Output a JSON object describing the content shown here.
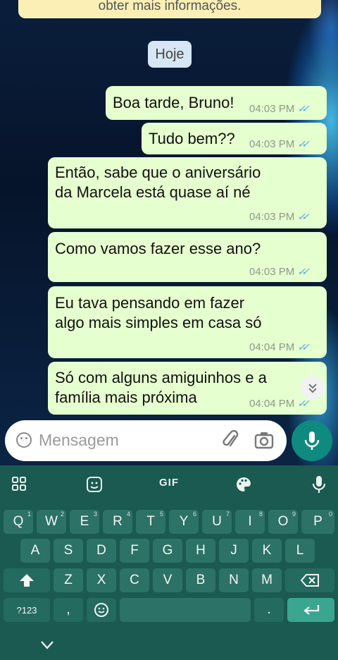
{
  "system_banner": "obter mais informações.",
  "date_chip": "Hoje",
  "messages": [
    {
      "text": "Boa tarde, Bruno!",
      "time": "04:03 PM"
    },
    {
      "text": "Tudo bem??",
      "time": "04:03 PM"
    },
    {
      "text_line1": "Então, sabe que o aniversário",
      "text_line2": "da Marcela está quase aí né",
      "time": "04:03 PM"
    },
    {
      "text": "Como vamos fazer esse ano?",
      "time": "04:03 PM"
    },
    {
      "text_line1": "Eu tava pensando em fazer",
      "text_line2": "algo mais simples em casa só",
      "time": "04:04 PM"
    },
    {
      "text_line1": "Só com alguns amiguinhos e a",
      "text_line2": "família mais próxima",
      "time": "04:04 PM"
    }
  ],
  "composer": {
    "placeholder": "Mensagem"
  },
  "keyboard": {
    "toolbar": {
      "gif": "GIF"
    },
    "row1": [
      {
        "key": "Q",
        "hint": "1"
      },
      {
        "key": "W",
        "hint": "2"
      },
      {
        "key": "E",
        "hint": "3"
      },
      {
        "key": "R",
        "hint": "4"
      },
      {
        "key": "T",
        "hint": "5"
      },
      {
        "key": "Y",
        "hint": "6"
      },
      {
        "key": "U",
        "hint": "7"
      },
      {
        "key": "I",
        "hint": "8"
      },
      {
        "key": "O",
        "hint": "9"
      },
      {
        "key": "P",
        "hint": "0"
      }
    ],
    "row2": [
      "A",
      "S",
      "D",
      "F",
      "G",
      "H",
      "J",
      "K",
      "L"
    ],
    "row3": [
      "Z",
      "X",
      "C",
      "V",
      "B",
      "N",
      "M"
    ],
    "row4": {
      "symbols": "?123",
      "comma": ",",
      "period": "."
    }
  },
  "icons": {
    "read_receipt": "double-check-icon",
    "scroll_down": "chevron-double-down-icon",
    "emoji": "emoji-icon",
    "attach": "paperclip-icon",
    "camera": "camera-icon",
    "mic": "microphone-icon"
  },
  "colors": {
    "outgoing_bubble": "#e6ffcf",
    "read_ticks": "#4fa6e6",
    "mic_button": "#0f8a7e",
    "keyboard_bg": "#1a5a50"
  }
}
